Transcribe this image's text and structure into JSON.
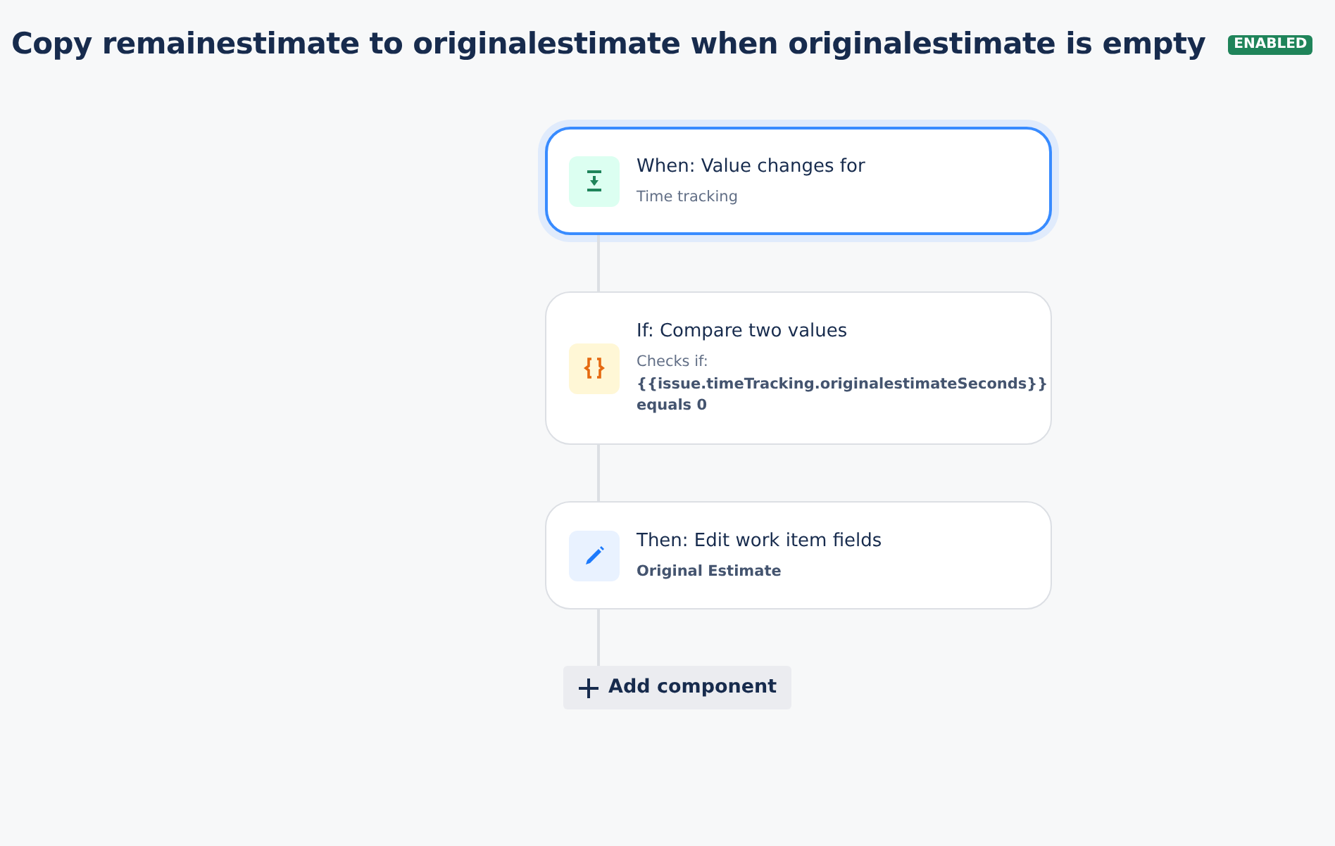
{
  "rule": {
    "title": "Copy remainestimate to originalestimate when originalestimate is empty",
    "status": "ENABLED"
  },
  "steps": [
    {
      "kind": "trigger",
      "selected": true,
      "title": "When: Value changes for",
      "details": [
        {
          "kind": "label",
          "text": "Time tracking"
        }
      ]
    },
    {
      "kind": "condition",
      "selected": false,
      "title": "If: Compare two values",
      "details": [
        {
          "kind": "label",
          "text": "Checks if:"
        },
        {
          "kind": "value",
          "text": "{{issue.timeTracking.originalestimateSeconds}}"
        },
        {
          "kind": "value",
          "text": "equals 0"
        }
      ]
    },
    {
      "kind": "action",
      "selected": false,
      "title": "Then: Edit work item fields",
      "details": [
        {
          "kind": "value",
          "text": "Original Estimate"
        }
      ]
    }
  ],
  "add_button": {
    "label": "Add component"
  }
}
